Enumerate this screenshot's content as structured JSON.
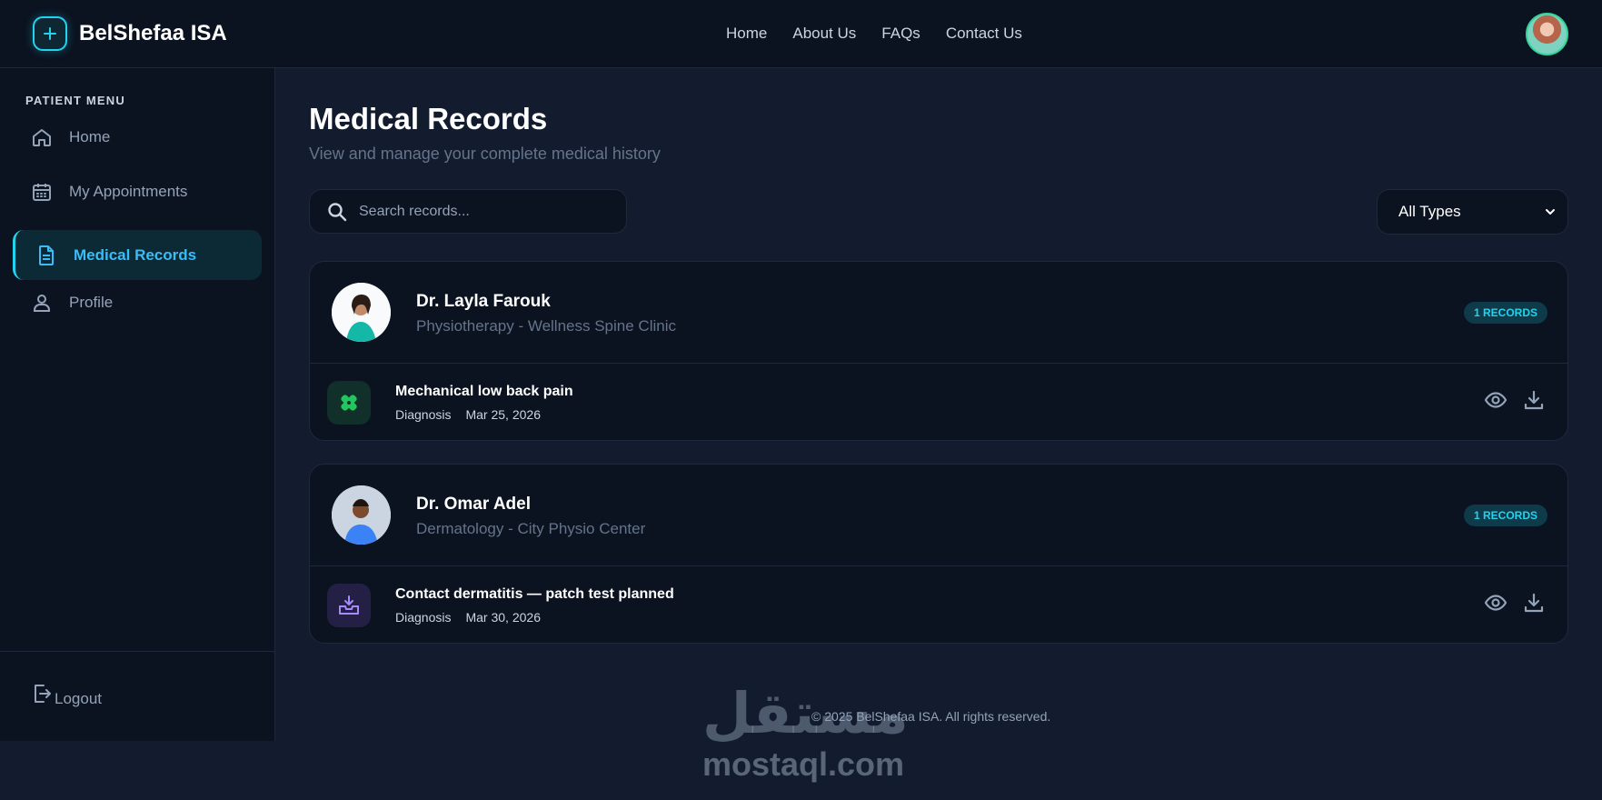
{
  "app": {
    "name": "BelShefaa ISA"
  },
  "nav": {
    "items": [
      {
        "label": "Home"
      },
      {
        "label": "About Us"
      },
      {
        "label": "FAQs"
      },
      {
        "label": "Contact Us"
      }
    ]
  },
  "sidebar": {
    "heading": "PATIENT MENU",
    "items": [
      {
        "label": "Home",
        "icon": "home-icon"
      },
      {
        "label": "My Appointments",
        "icon": "calendar-icon"
      },
      {
        "label": "Medical Records",
        "icon": "document-icon",
        "active": true
      },
      {
        "label": "Profile",
        "icon": "user-icon"
      }
    ],
    "logout_label": "Logout"
  },
  "main": {
    "title": "Medical Records",
    "subtitle": "View and manage your complete medical history",
    "search": {
      "placeholder": "Search records...",
      "value": ""
    },
    "filter": {
      "selected": "All Types"
    }
  },
  "doctors": [
    {
      "name": "Dr. Layla Farouk",
      "specialty": "Physiotherapy - Wellness Spine Clinic",
      "badge": "1 RECORDS",
      "record": {
        "title": "Mechanical low back pain",
        "type": "Diagnosis",
        "date": "Mar 25, 2026",
        "icon": "bandage-icon",
        "icon_color": "#22c55e"
      }
    },
    {
      "name": "Dr. Omar Adel",
      "specialty": "Dermatology - City Physio Center",
      "badge": "1 RECORDS",
      "record": {
        "title": "Contact dermatitis — patch test planned",
        "type": "Diagnosis",
        "date": "Mar 30, 2026",
        "icon": "tray-icon",
        "icon_color": "#a78bfa"
      }
    }
  ],
  "footer": {
    "copyright": "© 2025 BelShefaa ISA. All rights reserved."
  },
  "watermark": {
    "arabic": "مستقل",
    "latin": "mostaql.com"
  },
  "colors": {
    "accent": "#22d3ee",
    "background": "#131c2e",
    "surface": "#0b1220"
  }
}
